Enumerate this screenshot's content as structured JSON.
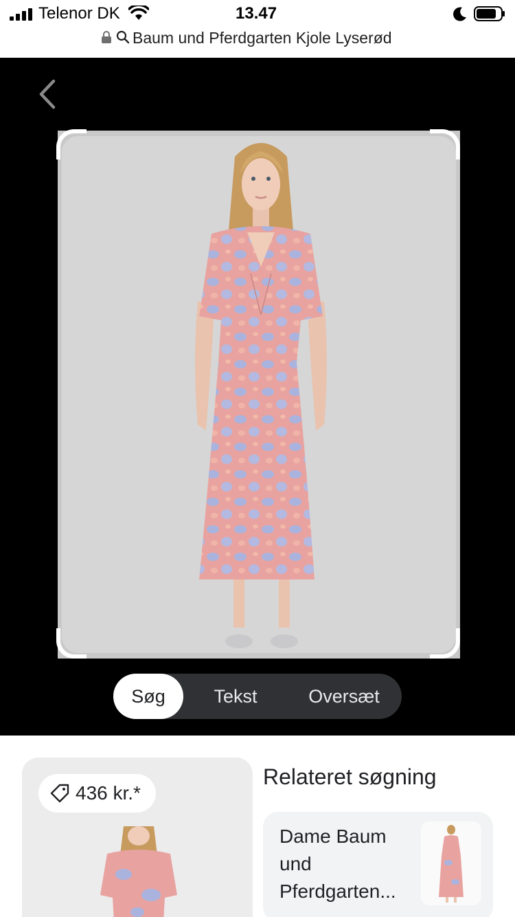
{
  "status_bar": {
    "carrier": "Telenor DK",
    "time": "13.47",
    "icons": [
      "signal-icon",
      "wifi-icon",
      "moon-icon",
      "battery-icon"
    ]
  },
  "url_bar": {
    "query": "Baum und Pferdgarten Kjole Lyserød",
    "icons": [
      "lock-icon",
      "search-icon"
    ]
  },
  "viewer": {
    "back_icon": "chevron-left-icon",
    "background": "#000000"
  },
  "mode_tabs": [
    {
      "label": "Søg",
      "selected": true
    },
    {
      "label": "Tekst",
      "selected": false
    },
    {
      "label": "Oversæt",
      "selected": false
    }
  ],
  "results": {
    "price": "436 kr.*",
    "price_icon": "tag-icon",
    "related_title": "Relateret søgning",
    "related_query": "Dame Baum und Pferdgarten..."
  },
  "colors": {
    "dress_pink": "#e8a3a0",
    "dress_lilac": "#a9b3de",
    "tab_bg": "#303134"
  }
}
